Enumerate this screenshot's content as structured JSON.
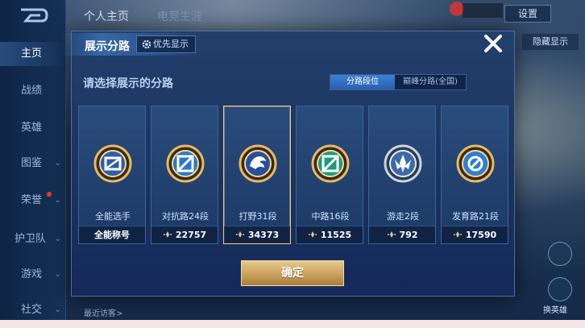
{
  "background": {
    "top_tabs": [
      "个人主页",
      "电竞生涯"
    ],
    "settings_label": "设置",
    "hide_label": "隐藏显示",
    "bottom_text": "最近访客>",
    "right_labels": [
      "换英雄"
    ]
  },
  "sidebar": {
    "items": [
      {
        "label": "主页",
        "active": true
      },
      {
        "label": "战绩",
        "active": false
      },
      {
        "label": "英雄",
        "active": false
      },
      {
        "label": "图鉴",
        "active": false
      },
      {
        "label": "荣誉",
        "active": false
      },
      {
        "label": "护卫队",
        "active": false
      },
      {
        "label": "游戏",
        "active": false
      },
      {
        "label": "社交",
        "active": false
      }
    ]
  },
  "modal": {
    "title": "展示分路",
    "priority_label": "优先显示",
    "prompt": "请选择展示的分路",
    "segments": [
      {
        "label": "分路段位",
        "active": true
      },
      {
        "label": "巅峰分路(全国)",
        "active": false
      }
    ],
    "cards": [
      {
        "name": "全能选手",
        "value": "全能称号",
        "has_icon": false,
        "selected": false,
        "badge": "all-round-badge-icon"
      },
      {
        "name": "对抗路24段",
        "value": "22757",
        "has_icon": true,
        "selected": false,
        "badge": "clash-lane-badge-icon"
      },
      {
        "name": "打野31段",
        "value": "34373",
        "has_icon": true,
        "selected": true,
        "badge": "jungle-badge-icon"
      },
      {
        "name": "中路16段",
        "value": "11525",
        "has_icon": true,
        "selected": false,
        "badge": "mid-lane-badge-icon"
      },
      {
        "name": "游走2段",
        "value": "792",
        "has_icon": true,
        "selected": false,
        "badge": "roam-badge-icon"
      },
      {
        "name": "发育路21段",
        "value": "17590",
        "has_icon": true,
        "selected": false,
        "badge": "farm-lane-badge-icon"
      }
    ],
    "confirm_label": "确定"
  },
  "colors": {
    "accent_gold": "#e8c98a",
    "active_blue": "#3f7fd3",
    "panel": "#1a3360"
  }
}
